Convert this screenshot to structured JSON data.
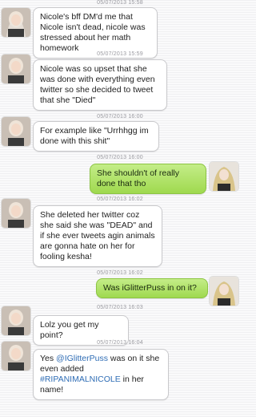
{
  "messages": [
    {
      "timestamp": "05/07/2013 15:58",
      "side": "in",
      "text": "Nicole's bff DM'd me that Nicole isn't dead, nicole was stressed about her math homework"
    },
    {
      "timestamp": "05/07/2013 15:59",
      "side": "in",
      "text": "Nicole was so upset that she was done with everything even twitter so she decided to tweet that she \"Died\""
    },
    {
      "timestamp": "05/07/2013 16:00",
      "side": "in",
      "text": "For example like \"Urrhhgg im done with this shit\""
    },
    {
      "timestamp": "05/07/2013 16:00",
      "side": "out",
      "text": "She shouldn't of really done that tho"
    },
    {
      "timestamp": "05/07/2013 16:02",
      "side": "in",
      "text": "She deleted her twitter coz she said she was \"DEAD\" and if she ever tweets agin animals are gonna hate on her for fooling kesha!"
    },
    {
      "timestamp": "05/07/2013 16:02",
      "side": "out",
      "text": "Was iGlitterPuss in on it?"
    },
    {
      "timestamp": "05/07/2013 16:03",
      "side": "in",
      "text": "Lolz you get my point?"
    },
    {
      "timestamp": "05/07/2013 16:04",
      "side": "in",
      "text_pre": "Yes ",
      "mention1": "@IGlitterPuss",
      "text_mid": " was on it she even added ",
      "mention2": "#RIPANIMALNICOLE",
      "text_post": " in her name!"
    }
  ],
  "colors": {
    "incoming_bubble": "#ffffff",
    "outgoing_bubble": "#a6dc58",
    "link": "#2f6db5"
  },
  "icons": {
    "contact_avatar": "contact-avatar-icon",
    "self_avatar": "self-avatar-icon"
  }
}
